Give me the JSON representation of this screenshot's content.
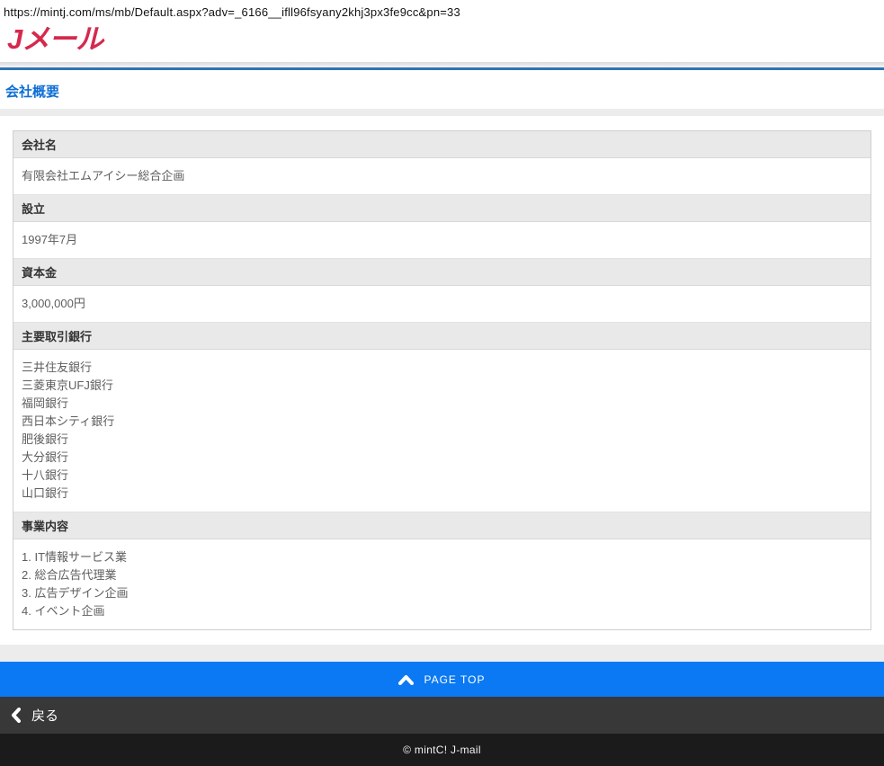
{
  "browser": {
    "url": "https://mintj.com/ms/mb/Default.aspx?adv=_6166__ifll96fsyany2khj3px3fe9cc&pn=33"
  },
  "header": {
    "logo_text": "Jメール",
    "page_title": "会社概要"
  },
  "company_table": {
    "rows": [
      {
        "label": "会社名",
        "values": [
          "有限会社エムアイシー総合企画"
        ]
      },
      {
        "label": "設立",
        "values": [
          "1997年7月"
        ]
      },
      {
        "label": "資本金",
        "values": [
          "3,000,000円"
        ]
      },
      {
        "label": "主要取引銀行",
        "values": [
          "三井住友銀行",
          "三菱東京UFJ銀行",
          "福岡銀行",
          "西日本シティ銀行",
          "肥後銀行",
          "大分銀行",
          "十八銀行",
          "山口銀行"
        ]
      },
      {
        "label": "事業内容",
        "values": [
          "1. IT情報サービス業",
          "2. 総合広告代理業",
          "3. 広告デザイン企画",
          "4. イベント企画"
        ]
      }
    ]
  },
  "page_top": {
    "label": "PAGE TOP",
    "icon": "chevron-up-icon"
  },
  "back_bar": {
    "label": "戻る",
    "icon": "chevron-left-icon"
  },
  "footer": {
    "copyright": "© mintC! J-mail"
  },
  "colors": {
    "logo_red": "#d5294d",
    "title_blue": "#0c6ed6",
    "divider_blue": "#2e73b5",
    "page_top_blue": "#0b79f3",
    "back_bar_gray": "#383838",
    "footer_black": "#1b1b1b"
  }
}
